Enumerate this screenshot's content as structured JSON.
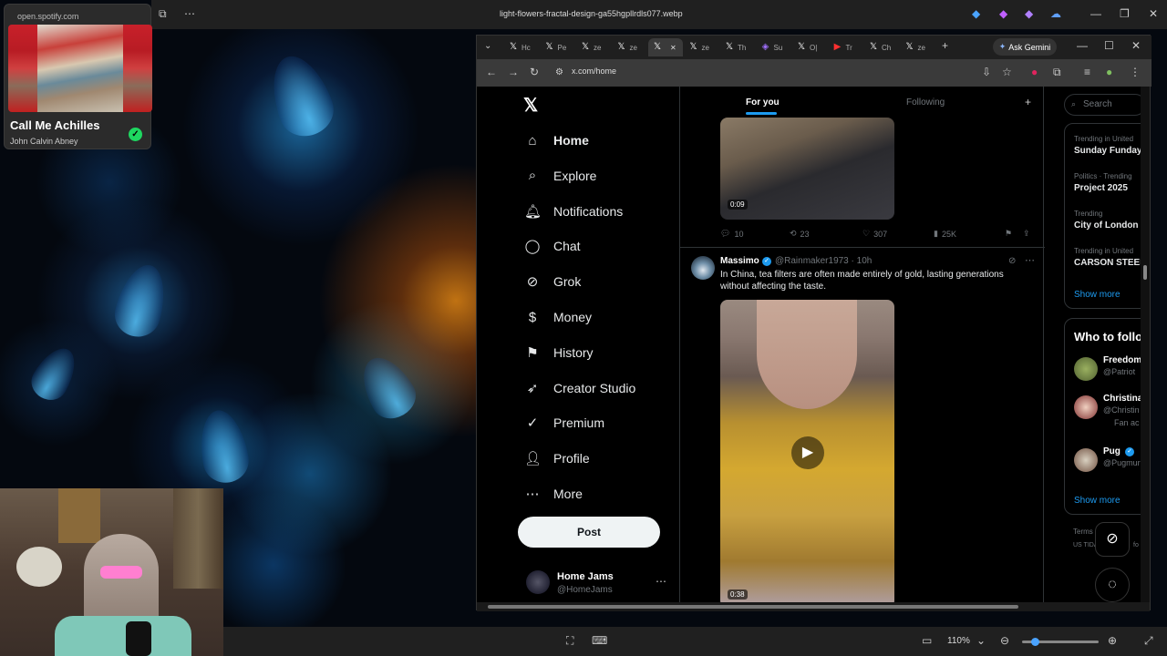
{
  "viewer": {
    "filename": "light-flowers-fractal-design-ga55hgpllrdls077.webp",
    "zoom": "110%"
  },
  "spotify": {
    "url": "open.spotify.com",
    "title": "Call Me Achilles",
    "artist": "John Calvin Abney"
  },
  "browser": {
    "tabs": [
      {
        "icon": "x-icon",
        "label": "Hc"
      },
      {
        "icon": "x-icon",
        "label": "Pe"
      },
      {
        "icon": "x-icon",
        "label": "ze"
      },
      {
        "icon": "x-icon",
        "label": "ze"
      },
      {
        "icon": "x-icon",
        "label": "",
        "active": true
      },
      {
        "icon": "x-icon",
        "label": "ze"
      },
      {
        "icon": "x-icon",
        "label": "Th"
      },
      {
        "icon": "app-icon",
        "label": "Su"
      },
      {
        "icon": "x-icon",
        "label": "O|"
      },
      {
        "icon": "youtube-icon",
        "label": "Tr"
      },
      {
        "icon": "x-icon",
        "label": "Ch"
      },
      {
        "icon": "x-icon",
        "label": "ze"
      }
    ],
    "ask_gemini": "Ask Gemini",
    "url": "x.com/home"
  },
  "x": {
    "nav": [
      {
        "name": "home",
        "label": "Home",
        "icon": "home-icon"
      },
      {
        "name": "explore",
        "label": "Explore",
        "icon": "search-icon"
      },
      {
        "name": "notifications",
        "label": "Notifications",
        "icon": "bell-icon"
      },
      {
        "name": "chat",
        "label": "Chat",
        "icon": "chat-icon"
      },
      {
        "name": "grok",
        "label": "Grok",
        "icon": "grok-icon"
      },
      {
        "name": "money",
        "label": "Money",
        "icon": "money-icon"
      },
      {
        "name": "history",
        "label": "History",
        "icon": "bookmark-icon"
      },
      {
        "name": "creator-studio",
        "label": "Creator Studio",
        "icon": "rocket-icon"
      },
      {
        "name": "premium",
        "label": "Premium",
        "icon": "premium-icon"
      },
      {
        "name": "profile",
        "label": "Profile",
        "icon": "user-icon"
      },
      {
        "name": "more",
        "label": "More",
        "icon": "more-icon"
      }
    ],
    "post_button": "Post",
    "account": {
      "name": "Home Jams",
      "handle": "@HomeJams"
    },
    "tabs": {
      "for_you": "For you",
      "following": "Following"
    },
    "prev_tweet": {
      "video_duration": "0:09",
      "replies": "10",
      "reposts": "23",
      "likes": "307",
      "views": "25K"
    },
    "tweet": {
      "name": "Massimo",
      "handle_time": "@Rainmaker1973 · 10h",
      "text": "In China, tea filters are often made entirely of gold, lasting generations without affecting the taste.",
      "video_duration": "0:38"
    },
    "search_placeholder": "Search",
    "trends": [
      {
        "meta": "Trending in United",
        "name": "Sunday Funday"
      },
      {
        "meta": "Politics · Trending",
        "name": "Project 2025"
      },
      {
        "meta": "Trending",
        "name": "City of London"
      },
      {
        "meta": "Trending in United",
        "name": "CARSON STEEL"
      }
    ],
    "show_more": "Show more",
    "who_to_follow_title": "Who to follo",
    "who_to_follow": [
      {
        "name": "Freedom",
        "handle": "@Patriot"
      },
      {
        "name": "Christina",
        "handle": "@Christin",
        "extra": "Fan ac"
      },
      {
        "name": "Pug",
        "handle": "@Pugmur"
      }
    ],
    "who_show_more": "Show more",
    "footer_terms": "Terms",
    "footer_us": "US TIDA",
    "footer_info": "fo"
  }
}
